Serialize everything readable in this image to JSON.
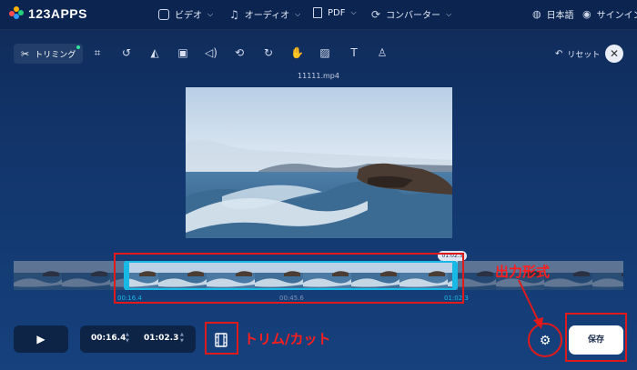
{
  "app": {
    "logo": "123APPS"
  },
  "nav": {
    "video": "ビデオ",
    "audio": "オーディオ",
    "pdf": "PDF",
    "converter": "コンバーター",
    "language": "日本語",
    "signin": "サインイン"
  },
  "toolbar": {
    "trim_label": "トリミング",
    "reset_label": "リセット",
    "close_label": "✕"
  },
  "file": {
    "name": "11111.mp4"
  },
  "timeline": {
    "start_time": "00:16.4",
    "mid_time": "00:45.6",
    "end_time": "01:02.3",
    "bubble": "01:02.3"
  },
  "controls": {
    "start_value": "00:16.4",
    "end_value": "01:02.3",
    "save_label": "保存"
  },
  "annotations": {
    "trim_cut": "トリム/カット",
    "output_format": "出力形式"
  },
  "colors": {
    "accent": "#19b9e6",
    "annotation_red": "#e01a1a",
    "background": "#12356b"
  }
}
